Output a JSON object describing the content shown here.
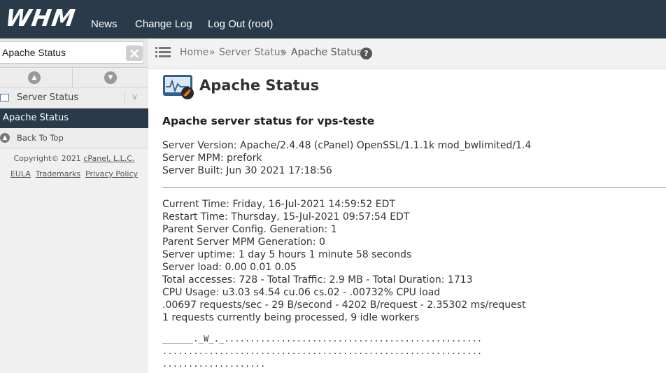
{
  "topbar": {
    "logo": "WHM",
    "nav": [
      "News",
      "Change Log",
      "Log Out (root)"
    ]
  },
  "sidebar": {
    "search_value": "Apache Status",
    "clear_icon": "close-icon",
    "section": "Server Status",
    "active_item": "Apache Status",
    "back_to_top": "Back To Top",
    "copyright_prefix": "Copyright© 2021 ",
    "copyright_link": "cPanel, L.L.C.",
    "legal": [
      "EULA",
      "Trademarks",
      "Privacy Policy"
    ]
  },
  "breadcrumb": {
    "home": "Home",
    "sep": "»",
    "parent": "Server Status",
    "current": "Apache Status"
  },
  "main": {
    "title": "Apache Status",
    "heading": "Apache server status for vps-teste",
    "server_info": [
      "Server Version: Apache/2.4.48 (cPanel) OpenSSL/1.1.1k mod_bwlimited/1.4",
      "Server MPM: prefork",
      "Server Built: Jun 30 2021 17:18:56"
    ],
    "stats": [
      "Current Time: Friday, 16-Jul-2021 14:59:52 EDT",
      "Restart Time: Thursday, 15-Jul-2021 09:57:54 EDT",
      "Parent Server Config. Generation: 1",
      "Parent Server MPM Generation: 0",
      "Server uptime: 1 day 5 hours 1 minute 58 seconds",
      "Server load: 0.00 0.01 0.05",
      "Total accesses: 728 - Total Traffic: 2.9 MB - Total Duration: 1713",
      "CPU Usage: u3.03 s4.54 cu.06 cs.02 - .00732% CPU load",
      ".00697 requests/sec - 29 B/second - 4202 B/request - 2.35302 ms/request",
      "1 requests currently being processed, 9 idle workers"
    ],
    "scoreboard": [
      "______._W_._..................................................",
      "..............................................................",
      "...................."
    ]
  },
  "colors": {
    "navbar": "#293a4a",
    "active": "#293a4a"
  }
}
